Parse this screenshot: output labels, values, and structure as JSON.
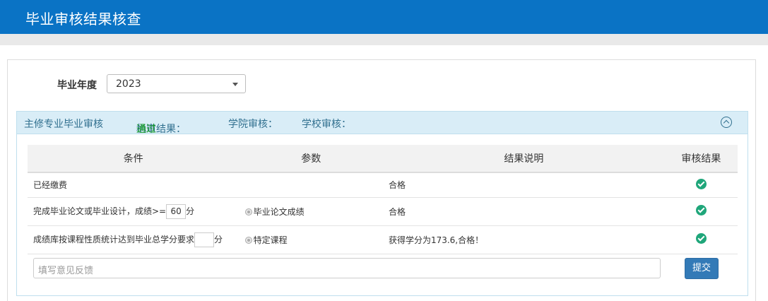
{
  "header": {
    "title": "毕业审核结果核查"
  },
  "filter": {
    "year_label": "毕业年度",
    "year_value": "2023"
  },
  "panel": {
    "title": "主修专业毕业审核",
    "machine_label": "机审结果：",
    "machine_value": "通过",
    "college_label": "学院审核：",
    "school_label": "学校审核："
  },
  "table": {
    "headers": [
      "条件",
      "参数",
      "结果说明",
      "审核结果"
    ],
    "rows": [
      {
        "cond_pre": "已经缴费",
        "cond_value": "",
        "cond_post": "",
        "param": "",
        "result": "合格",
        "status": "check-icon"
      },
      {
        "cond_pre": "完成毕业论文或毕业设计，成绩>=",
        "cond_value": "60",
        "cond_post": "分",
        "param": "毕业论文成绩",
        "result": "合格",
        "status": "check-icon"
      },
      {
        "cond_pre": "成绩库按课程性质统计达到毕业总学分要求",
        "cond_value": "",
        "cond_post": "分",
        "param": "特定课程",
        "result": "获得学分为173.6,合格！",
        "status": "check-icon"
      }
    ]
  },
  "feedback": {
    "placeholder": "填写意见反馈",
    "submit_label": "提交"
  },
  "colors": {
    "header_bg": "#0a73c5",
    "panel_head_bg": "#d9edf7",
    "pass": "#0a9a1a",
    "check": "#1fa67a",
    "button": "#337ab7"
  }
}
